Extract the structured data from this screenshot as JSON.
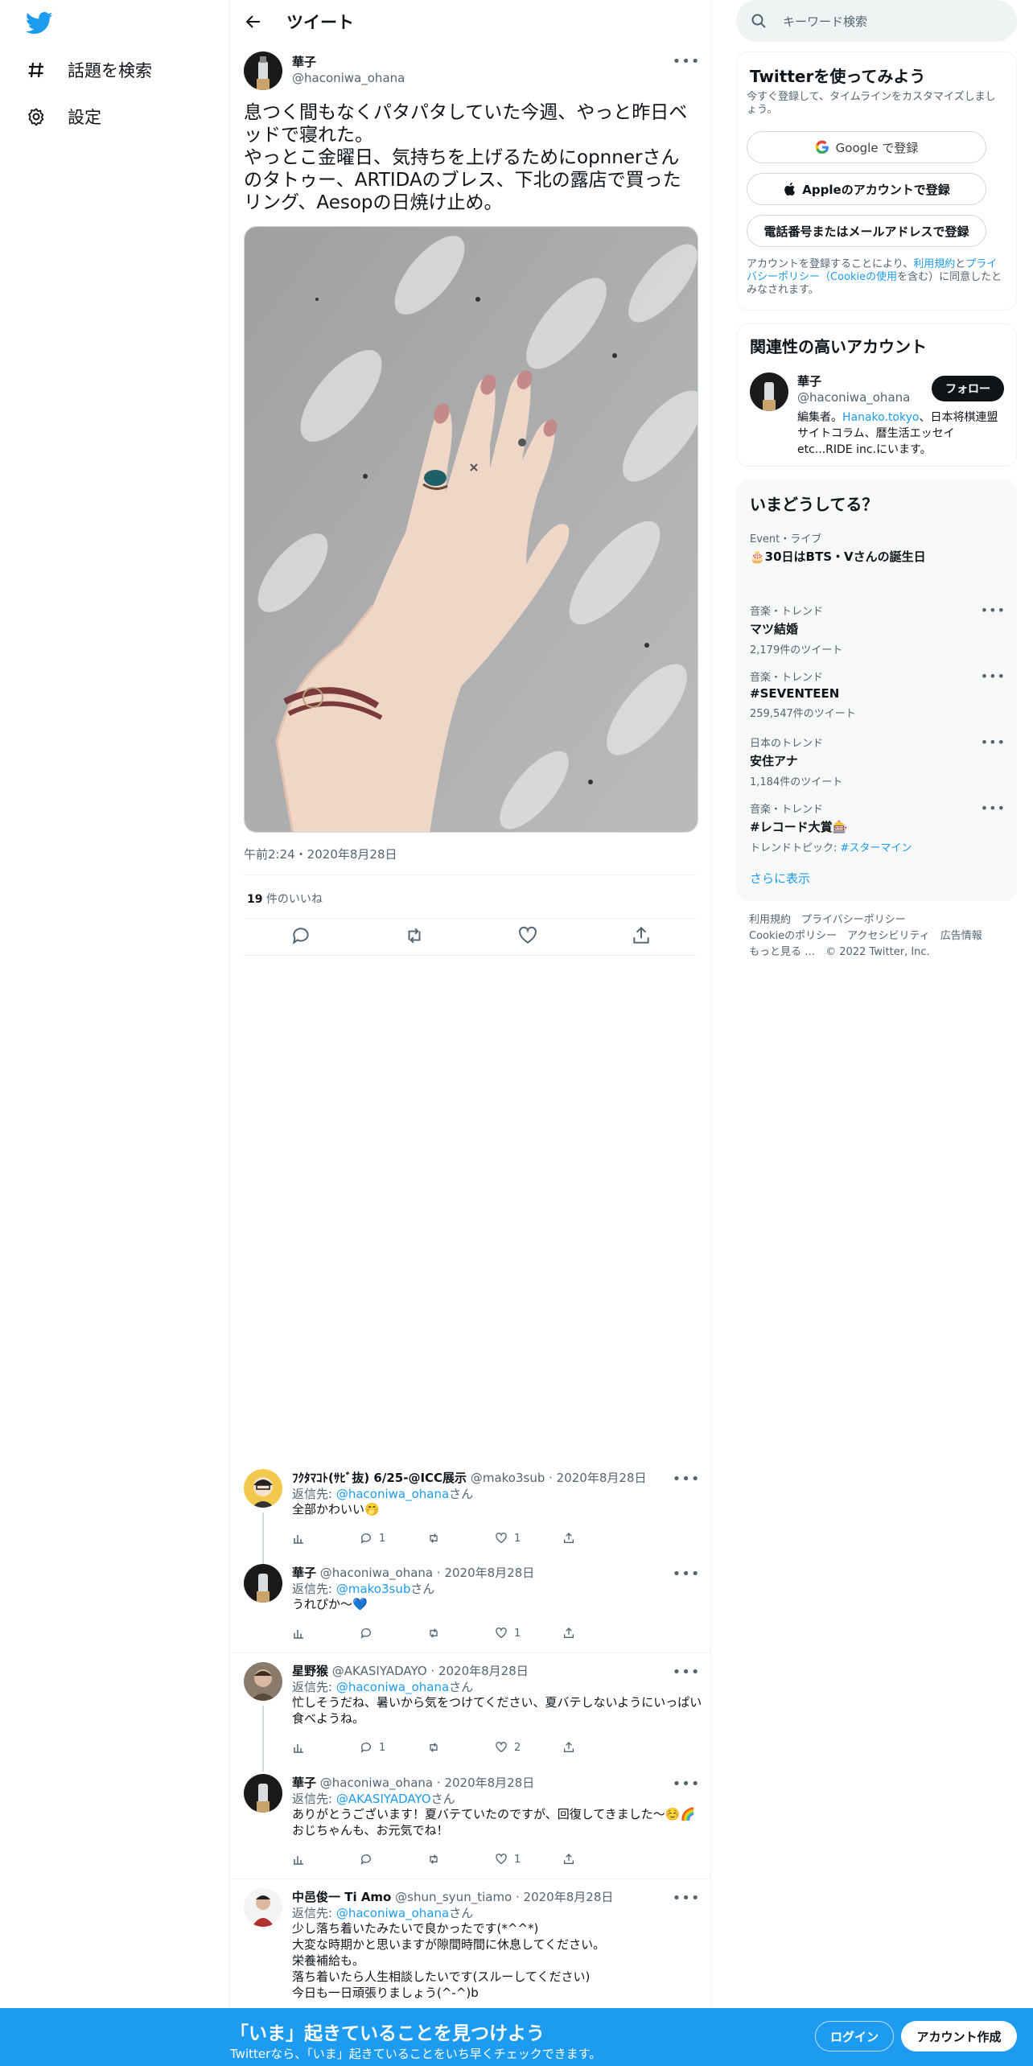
{
  "nav": {
    "explore_label": "話題を検索",
    "settings_label": "設定",
    "twitter_blue": "#1d9bf0"
  },
  "header": {
    "title": "ツイート"
  },
  "tweet": {
    "author_name": "華子",
    "author_handle": "@haconiwa_ohana",
    "text": "息つく間もなくパタパタしていた今週、やっと昨日ベッドで寝れた。\nやっとこ金曜日、気持ちを上げるためにopnnerさんのタトゥー、ARTIDAのブレス、下北の露店で買ったリング、Aesopの日焼け止め。",
    "time": "午前2:24・2020年8月28日",
    "like_count": "19",
    "like_label": " 件のいいね"
  },
  "replies": [
    {
      "name": "ﾌｸﾀﾏｺﾄ(ｻﾋﾞ抜) 6/25-@ICC展示",
      "handle": "@mako3sub",
      "date": "· 2020年8月28日",
      "reply_prefix": "返信先: ",
      "reply_to": "@haconiwa_ohana",
      "reply_suffix": "さん",
      "text": "全部かわいい🤭",
      "replies": "1",
      "retweets": "",
      "likes": "1"
    },
    {
      "name": "華子",
      "handle": "@haconiwa_ohana",
      "date": "· 2020年8月28日",
      "reply_prefix": "返信先: ",
      "reply_to": "@mako3sub",
      "reply_suffix": "さん",
      "text": "うれぴか〜💙",
      "replies": "",
      "retweets": "",
      "likes": "1"
    },
    {
      "name": "星野猴",
      "handle": "@AKASIYADAYO",
      "date": "· 2020年8月28日",
      "reply_prefix": "返信先: ",
      "reply_to": "@haconiwa_ohana",
      "reply_suffix": "さん",
      "text": "忙しそうだね、暑いから気をつけてください、夏バテしないようにいっぱい食べようね。",
      "replies": "1",
      "retweets": "",
      "likes": "2"
    },
    {
      "name": "華子",
      "handle": "@haconiwa_ohana",
      "date": "· 2020年8月28日",
      "reply_prefix": "返信先: ",
      "reply_to": "@AKASIYADAYO",
      "reply_suffix": "さん",
      "text": "ありがとうございます！夏バテていたのですが、回復してきました〜☺️🌈\nおじちゃんも、お元気でね！",
      "replies": "",
      "retweets": "",
      "likes": "1"
    },
    {
      "name": "中邑俊一 Ti Amo",
      "handle": "@shun_syun_tiamo",
      "date": "· 2020年8月28日",
      "reply_prefix": "返信先: ",
      "reply_to": "@haconiwa_ohana",
      "reply_suffix": "さん",
      "text": "少し落ち着いたみたいで良かったです(*^^*)\n大変な時期かと思いますが隙間時間に休息してください。\n栄養補給も。\n落ち着いたら人生相談したいです(スルーしてください)\n今日も一日頑張りましょう(^-^)b"
    }
  ],
  "sidebar": {
    "search_placeholder": "キーワード検索",
    "signup": {
      "title": "Twitterを使ってみよう",
      "subtitle": "今すぐ登録して、タイムラインをカスタマイズしましょう。",
      "google_label": "Google で登録",
      "apple_label": "Appleのアカウントで登録",
      "email_label": "電話番号またはメールアドレスで登録",
      "terms_prefix": "アカウントを登録することにより、",
      "terms_link": "利用規約",
      "terms_mid": "と",
      "privacy_link": "プライバシーポリシー（Cookieの使用",
      "terms_suffix": "を含む）に同意したとみなされます。"
    },
    "relevant": {
      "title": "関連性の高いアカウント",
      "name": "華子",
      "handle": "@haconiwa_ohana",
      "follow_label": "フォロー",
      "bio_prefix": "編集者。",
      "bio_link": "Hanako.tokyo",
      "bio_suffix": "、日本将棋連盟サイトコラム、暦生活エッセイetc...RIDE inc.にいます。"
    },
    "trends": {
      "title": "いまどうしてる？",
      "event_cat": "Event・ライブ",
      "event_name": "🎂30日はBTS・Vさんの誕生日",
      "items": [
        {
          "cat": "音楽・トレンド",
          "name": "マツ結婚",
          "count": "2,179件のツイート"
        },
        {
          "cat": "音楽・トレンド",
          "name": "#SEVENTEEN",
          "count": "259,547件のツイート"
        },
        {
          "cat": "日本のトレンド",
          "name": "安住アナ",
          "count": "1,184件のツイート"
        },
        {
          "cat": "音楽・トレンド",
          "name": "#レコード大賞🎰",
          "count_prefix": "トレンドトピック: ",
          "count_link": "#スターマイン"
        }
      ],
      "show_more": "さらに表示"
    },
    "footer": {
      "line1a": "利用規約",
      "line1b": "プライバシーポリシー",
      "line2a": "Cookieのポリシー",
      "line2b": "アクセシビリティ",
      "line2c": "広告情報",
      "line3a": "もっと見る …",
      "line3b": "© 2022 Twitter, Inc."
    }
  },
  "bottom": {
    "headline": "「いま」起きていることを見つけよう",
    "sub": "Twitterなら、「いま」起きていることをいち早くチェックできます。",
    "login_label": "ログイン",
    "signup_label": "アカウント作成"
  }
}
